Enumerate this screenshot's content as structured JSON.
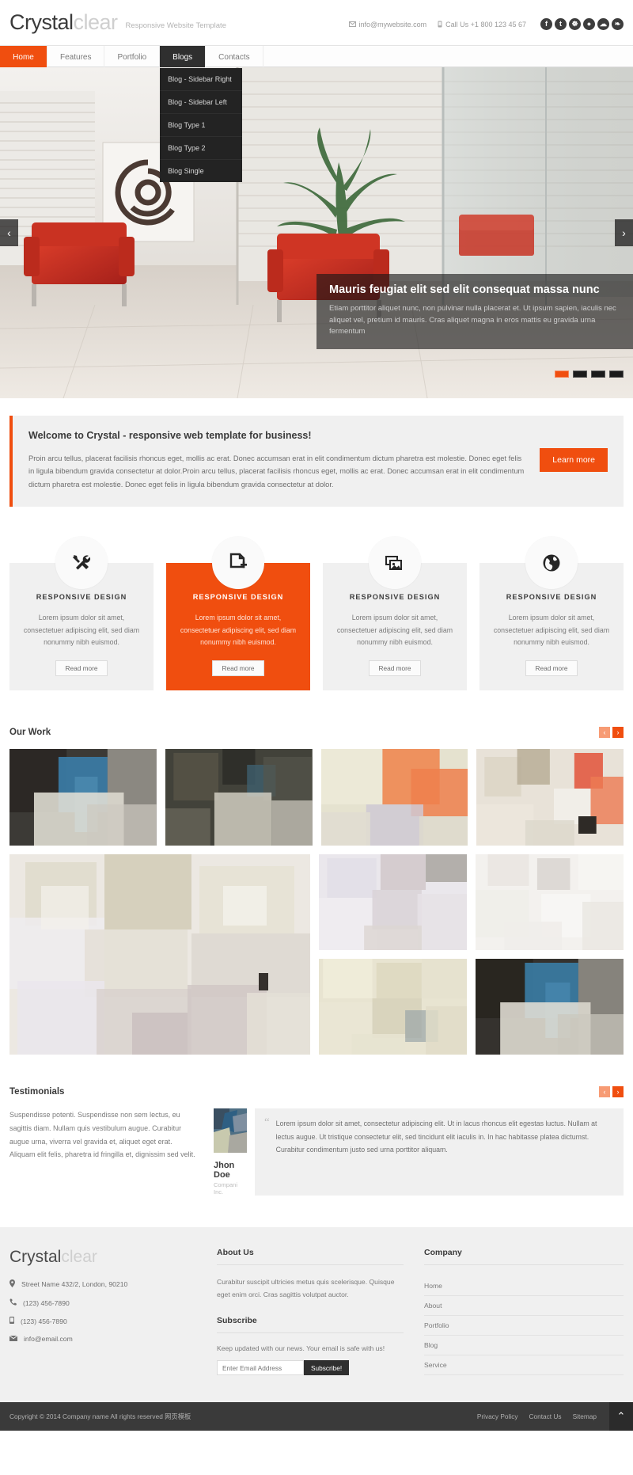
{
  "header": {
    "logo_main": "Crystal",
    "logo_accent": "clear",
    "tagline": "Responsive Website Template",
    "email": "info@mywebsite.com",
    "phone": "Call Us +1 800 123 45 67",
    "socials": [
      {
        "name": "facebook-icon",
        "glyph": "f"
      },
      {
        "name": "tumblr-icon",
        "glyph": "t"
      },
      {
        "name": "wheel-icon",
        "glyph": "☸"
      },
      {
        "name": "dribbble-icon",
        "glyph": "●"
      },
      {
        "name": "cloud-icon",
        "glyph": "☁"
      },
      {
        "name": "flame-icon",
        "glyph": "❧"
      }
    ]
  },
  "nav": {
    "items": [
      {
        "label": "Home",
        "state": "active-orange"
      },
      {
        "label": "Features",
        "state": ""
      },
      {
        "label": "Portfolio",
        "state": ""
      },
      {
        "label": "Blogs",
        "state": "active-dark"
      },
      {
        "label": "Contacts",
        "state": ""
      }
    ],
    "dropdown": [
      "Blog - Sidebar Right",
      "Blog - Sidebar Left",
      "Blog Type 1",
      "Blog Type 2",
      "Blog Single"
    ]
  },
  "slider": {
    "prev_glyph": "‹",
    "next_glyph": "›",
    "caption_title": "Mauris feugiat elit sed elit consequat massa nunc",
    "caption_text": "Etiam porttitor aliquet nunc, non pulvinar nulla placerat et. Ut ipsum sapien, iaculis nec aliquet vel, pretium id mauris. Cras aliquet magna in eros mattis eu gravida urna fermentum",
    "pager": [
      true,
      false,
      false,
      false
    ]
  },
  "welcome": {
    "title": "Welcome to Crystal - responsive web template for business!",
    "text": "Proin arcu tellus, placerat facilisis rhoncus eget, mollis ac erat. Donec accumsan erat in elit condimentum dictum pharetra est molestie. Donec eget felis in ligula bibendum gravida consectetur at dolor.Proin arcu tellus, placerat facilisis rhoncus eget, mollis ac erat. Donec accumsan erat in elit condimentum dictum pharetra est molestie. Donec eget felis in ligula bibendum gravida consectetur at dolor.",
    "button": "Learn more"
  },
  "services": {
    "items": [
      {
        "icon": "tools-icon",
        "title": "RESPONSIVE DESIGN",
        "text": "Lorem ipsum dolor sit amet, consectetuer adipiscing elit, sed diam nonummy nibh euismod.",
        "button": "Read more",
        "highlight": false
      },
      {
        "icon": "document-add-icon",
        "title": "RESPONSIVE DESIGN",
        "text": "Lorem ipsum dolor sit amet, consectetuer adipiscing elit, sed diam nonummy nibh euismod.",
        "button": "Read more",
        "highlight": true
      },
      {
        "icon": "gallery-icon",
        "title": "RESPONSIVE DESIGN",
        "text": "Lorem ipsum dolor sit amet, consectetuer adipiscing elit, sed diam nonummy nibh euismod.",
        "button": "Read more",
        "highlight": false
      },
      {
        "icon": "globe-icon",
        "title": "RESPONSIVE DESIGN",
        "text": "Lorem ipsum dolor sit amet, consectetuer adipiscing elit, sed diam nonummy nibh euismod.",
        "button": "Read more",
        "highlight": false
      }
    ]
  },
  "our_work": {
    "title": "Our Work",
    "prev_glyph": "‹",
    "next_glyph": "›"
  },
  "testimonials": {
    "title": "Testimonials",
    "prev_glyph": "‹",
    "next_glyph": "›",
    "intro": "Suspendisse potenti. Suspendisse non sem lectus, eu sagittis diam. Nullam quis vestibulum augue. Curabitur augue urna, viverra vel gravida et, aliquet eget erat. Aliquam elit felis, pharetra id fringilla et, dignissim sed velit.",
    "quote_mark": "“",
    "quote": "Lorem ipsum dolor sit amet, consectetur adipiscing elit. Ut in lacus rhoncus elit egestas luctus. Nullam at lectus augue. Ut tristique consectetur elit, sed tincidunt elit iaculis in. In hac habitasse platea dictumst. Curabitur condimentum justo sed urna porttitor aliquam.",
    "author_name": "Jhon Doe",
    "author_company": "Compani Inc."
  },
  "footer": {
    "logo_main": "Crystal",
    "logo_accent": "clear",
    "address": "Street Name 432/2, London, 90210",
    "phone": "(123) 456-7890",
    "mobile": "(123) 456-7890",
    "email": "info@email.com",
    "about_title": "About Us",
    "about_text": "Curabitur suscipit ultricies metus quis scelerisque. Quisque eget enim orci. Cras sagittis volutpat auctor.",
    "subscribe_title": "Subscribe",
    "subscribe_note": "Keep updated with our news. Your email is safe with us!",
    "subscribe_placeholder": "Enter Email Address",
    "subscribe_button": "Subscribe!",
    "company_title": "Company",
    "company_links": [
      "Home",
      "About",
      "Portfolio",
      "Blog",
      "Service"
    ]
  },
  "copyright": {
    "text": "Copyright © 2014 Company name All rights reserved 网页模板",
    "links": [
      "Privacy Policy",
      "Contact Us",
      "Sitemap"
    ],
    "totop_glyph": "⌃"
  },
  "colors": {
    "accent": "#f04e0f",
    "dark": "#2f2f2f",
    "panel": "#f0f0f0"
  }
}
